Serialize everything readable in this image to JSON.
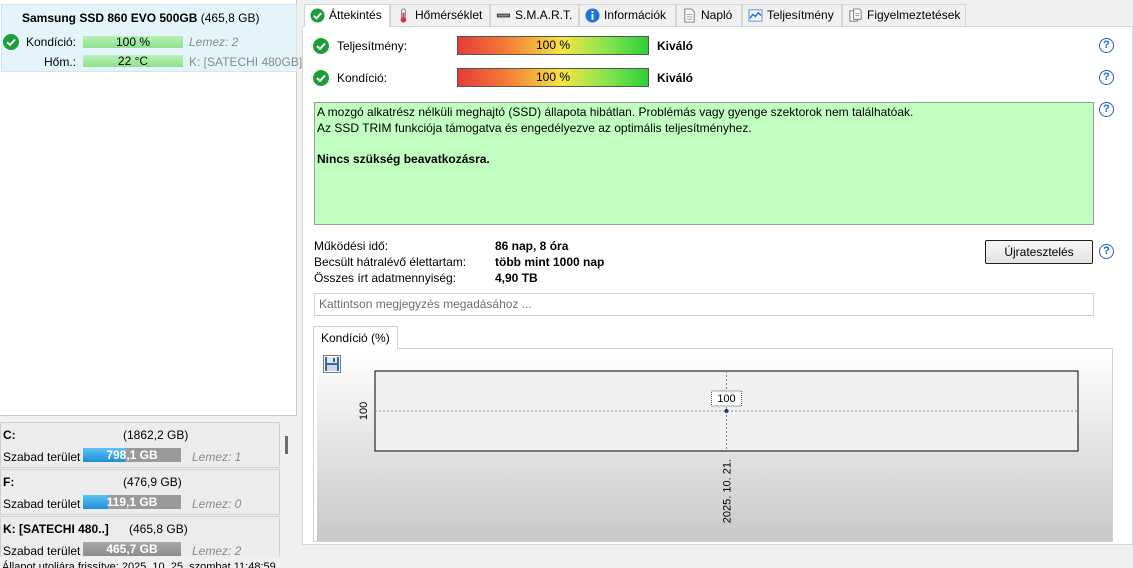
{
  "disk": {
    "name": "Samsung SSD 860 EVO 500GB",
    "size": "(465,8 GB)",
    "kondicio_label": "Kondíció:",
    "kondicio_value": "100 %",
    "kondicio_fraction": 1.0,
    "lemez": "Lemez: 2",
    "hom_label": "Hőm.:",
    "hom_value": "22 °C",
    "drive": "K: [SATECHI 480GB]"
  },
  "volumes": [
    {
      "name": "C:",
      "size": "(1862,2 GB)",
      "free_label": "Szabad terület",
      "free": "798,1 GB",
      "free_fraction": 0.43,
      "lemez": "Lemez: 1"
    },
    {
      "name": "F:",
      "size": "(476,9 GB)",
      "free_label": "Szabad terület",
      "free": "119,1 GB",
      "free_fraction": 0.25,
      "lemez": "Lemez: 0"
    },
    {
      "name": "K: [SATECHI 480..]",
      "size": "(465,8 GB)",
      "free_label": "Szabad terület",
      "free": "465,7 GB",
      "free_fraction": 1.0,
      "lemez": "Lemez: 2"
    }
  ],
  "status_bar": "Állapot utoljára frissítve: 2025. 10. 25. szombat 11:48:59",
  "tabs": [
    {
      "label": "Áttekintés",
      "icon": "check-circle-icon"
    },
    {
      "label": "Hőmérséklet",
      "icon": "thermometer-icon"
    },
    {
      "label": "S.M.A.R.T.",
      "icon": "smart-icon"
    },
    {
      "label": "Információk",
      "icon": "info-icon"
    },
    {
      "label": "Napló",
      "icon": "document-icon"
    },
    {
      "label": "Teljesítmény",
      "icon": "chart-icon"
    },
    {
      "label": "Figyelmeztetések",
      "icon": "warnings-icon"
    }
  ],
  "overview": {
    "performance_label": "Teljesítmény:",
    "performance_value": "100 %",
    "performance_rating": "Kiváló",
    "condition_label": "Kondíció:",
    "condition_value": "100 %",
    "condition_rating": "Kiváló",
    "description_line1": "A mozgó alkatrész nélküli meghajtó (SSD) állapota hibátlan. Problémás vagy gyenge szektorok nem találhatóak.",
    "description_line2": "Az SSD TRIM funkciója támogatva és engedélyezve az optimális teljesítményhez.",
    "description_line3": "Nincs szükség beavatkozásra.",
    "uptime_label": "Működési idő:",
    "uptime_value": "86 nap, 8 óra",
    "lifetime_label": "Becsült hátralévő élettartam:",
    "lifetime_value": "több mint 1000 nap",
    "written_label": "Összes írt adatmennyiség:",
    "written_value": "4,90 TB",
    "retest_button": "Újratesztelés",
    "note_placeholder": "Kattintson megjegyzés megadásához ..."
  },
  "chart_tab": "Kondíció  (%)",
  "chart_data": {
    "type": "line",
    "x": [
      "2025. 10. 21."
    ],
    "series": [
      {
        "values": [
          100
        ]
      }
    ],
    "ytick": "100",
    "point_label": "100"
  },
  "colors": {
    "accent_green": "#1e9e3b",
    "description_bg": "#c1ffc1",
    "help_blue": "#1e63c8",
    "volume_blue": "#1e8fd6"
  }
}
